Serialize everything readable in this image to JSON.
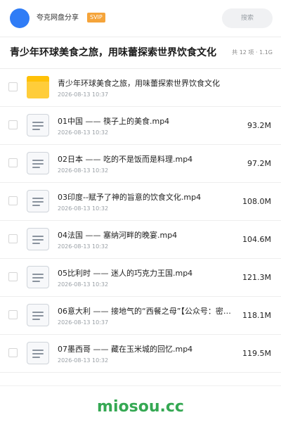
{
  "header": {
    "app_name": "夸克网盘分享",
    "badge": "SVIP",
    "search_placeholder": "搜索",
    "brand_color": "#2f7cf6"
  },
  "folder": {
    "title": "青少年环球美食之旅，用味蕾探索世界饮食文化",
    "meta": "共 12 项 · 1.1G"
  },
  "items": [
    {
      "type": "folder",
      "name": "青少年环球美食之旅，用味蕾探索世界饮食文化",
      "date": "2026-08-13 10:37",
      "size": ""
    },
    {
      "type": "file",
      "name": "01中国 —— 筷子上的美食.mp4",
      "date": "2026-08-13 10:32",
      "size": "93.2M"
    },
    {
      "type": "file",
      "name": "02日本 —— 吃的不是饭而是料理.mp4",
      "date": "2026-08-13 10:32",
      "size": "97.2M"
    },
    {
      "type": "file",
      "name": "03印度--赋予了神的旨意的饮食文化.mp4",
      "date": "2026-08-13 10:32",
      "size": "108.0M"
    },
    {
      "type": "file",
      "name": "04法国 —— 塞纳河畔的晚宴.mp4",
      "date": "2026-08-13 10:32",
      "size": "104.6M"
    },
    {
      "type": "file",
      "name": "05比利时 —— 迷人的巧克力王国.mp4",
      "date": "2026-08-13 10:32",
      "size": "121.3M"
    },
    {
      "type": "file",
      "name": "06意大利 —— 接地气的“西餐之母”【公众号：密…",
      "date": "2026-08-13 10:37",
      "size": "118.1M"
    },
    {
      "type": "file",
      "name": "07墨西哥 —— 藏在玉米城的回忆.mp4",
      "date": "2026-08-13 10:32",
      "size": "119.5M"
    }
  ],
  "watermark": "miosou.cc"
}
